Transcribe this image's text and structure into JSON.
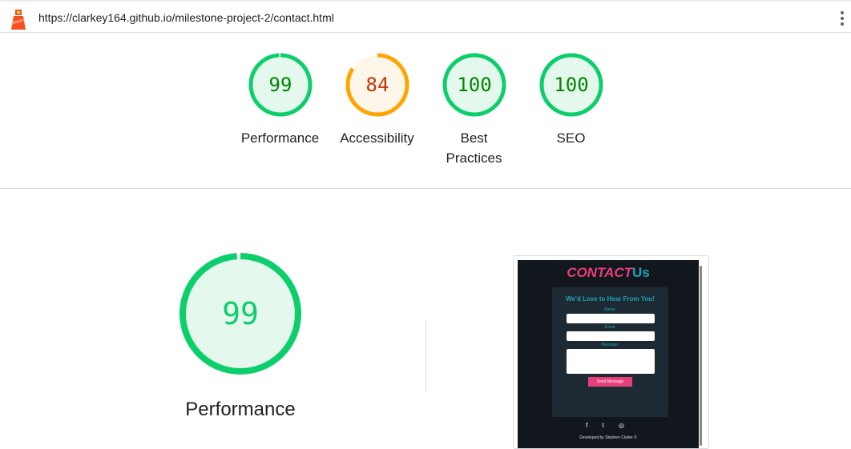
{
  "browser": {
    "url": "https://clarkey164.github.io/milestone-project-2/contact.html"
  },
  "colors": {
    "pass": "#0cce6b",
    "pass_text": "#008800",
    "pass_fill": "#e5f8ed",
    "avg": "#ffa400",
    "avg_text": "#c33300",
    "avg_fill": "#fff6ea"
  },
  "gauges": [
    {
      "score": 99,
      "label": "Performance"
    },
    {
      "score": 84,
      "label": "Accessibility"
    },
    {
      "score": 100,
      "label": "Best Practices"
    },
    {
      "score": 100,
      "label": "SEO"
    }
  ],
  "main": {
    "score": 99,
    "label": "Performance"
  },
  "screenshot": {
    "title_a": "CONTACT",
    "title_b": "Us",
    "heading": "We'd Love to Hear From You!",
    "name_label": "Name:",
    "email_label": "Email:",
    "message_label": "Message:",
    "button": "Send Message",
    "social": "f t ◎",
    "footer": "Developed by Stephen Clarke ©"
  }
}
